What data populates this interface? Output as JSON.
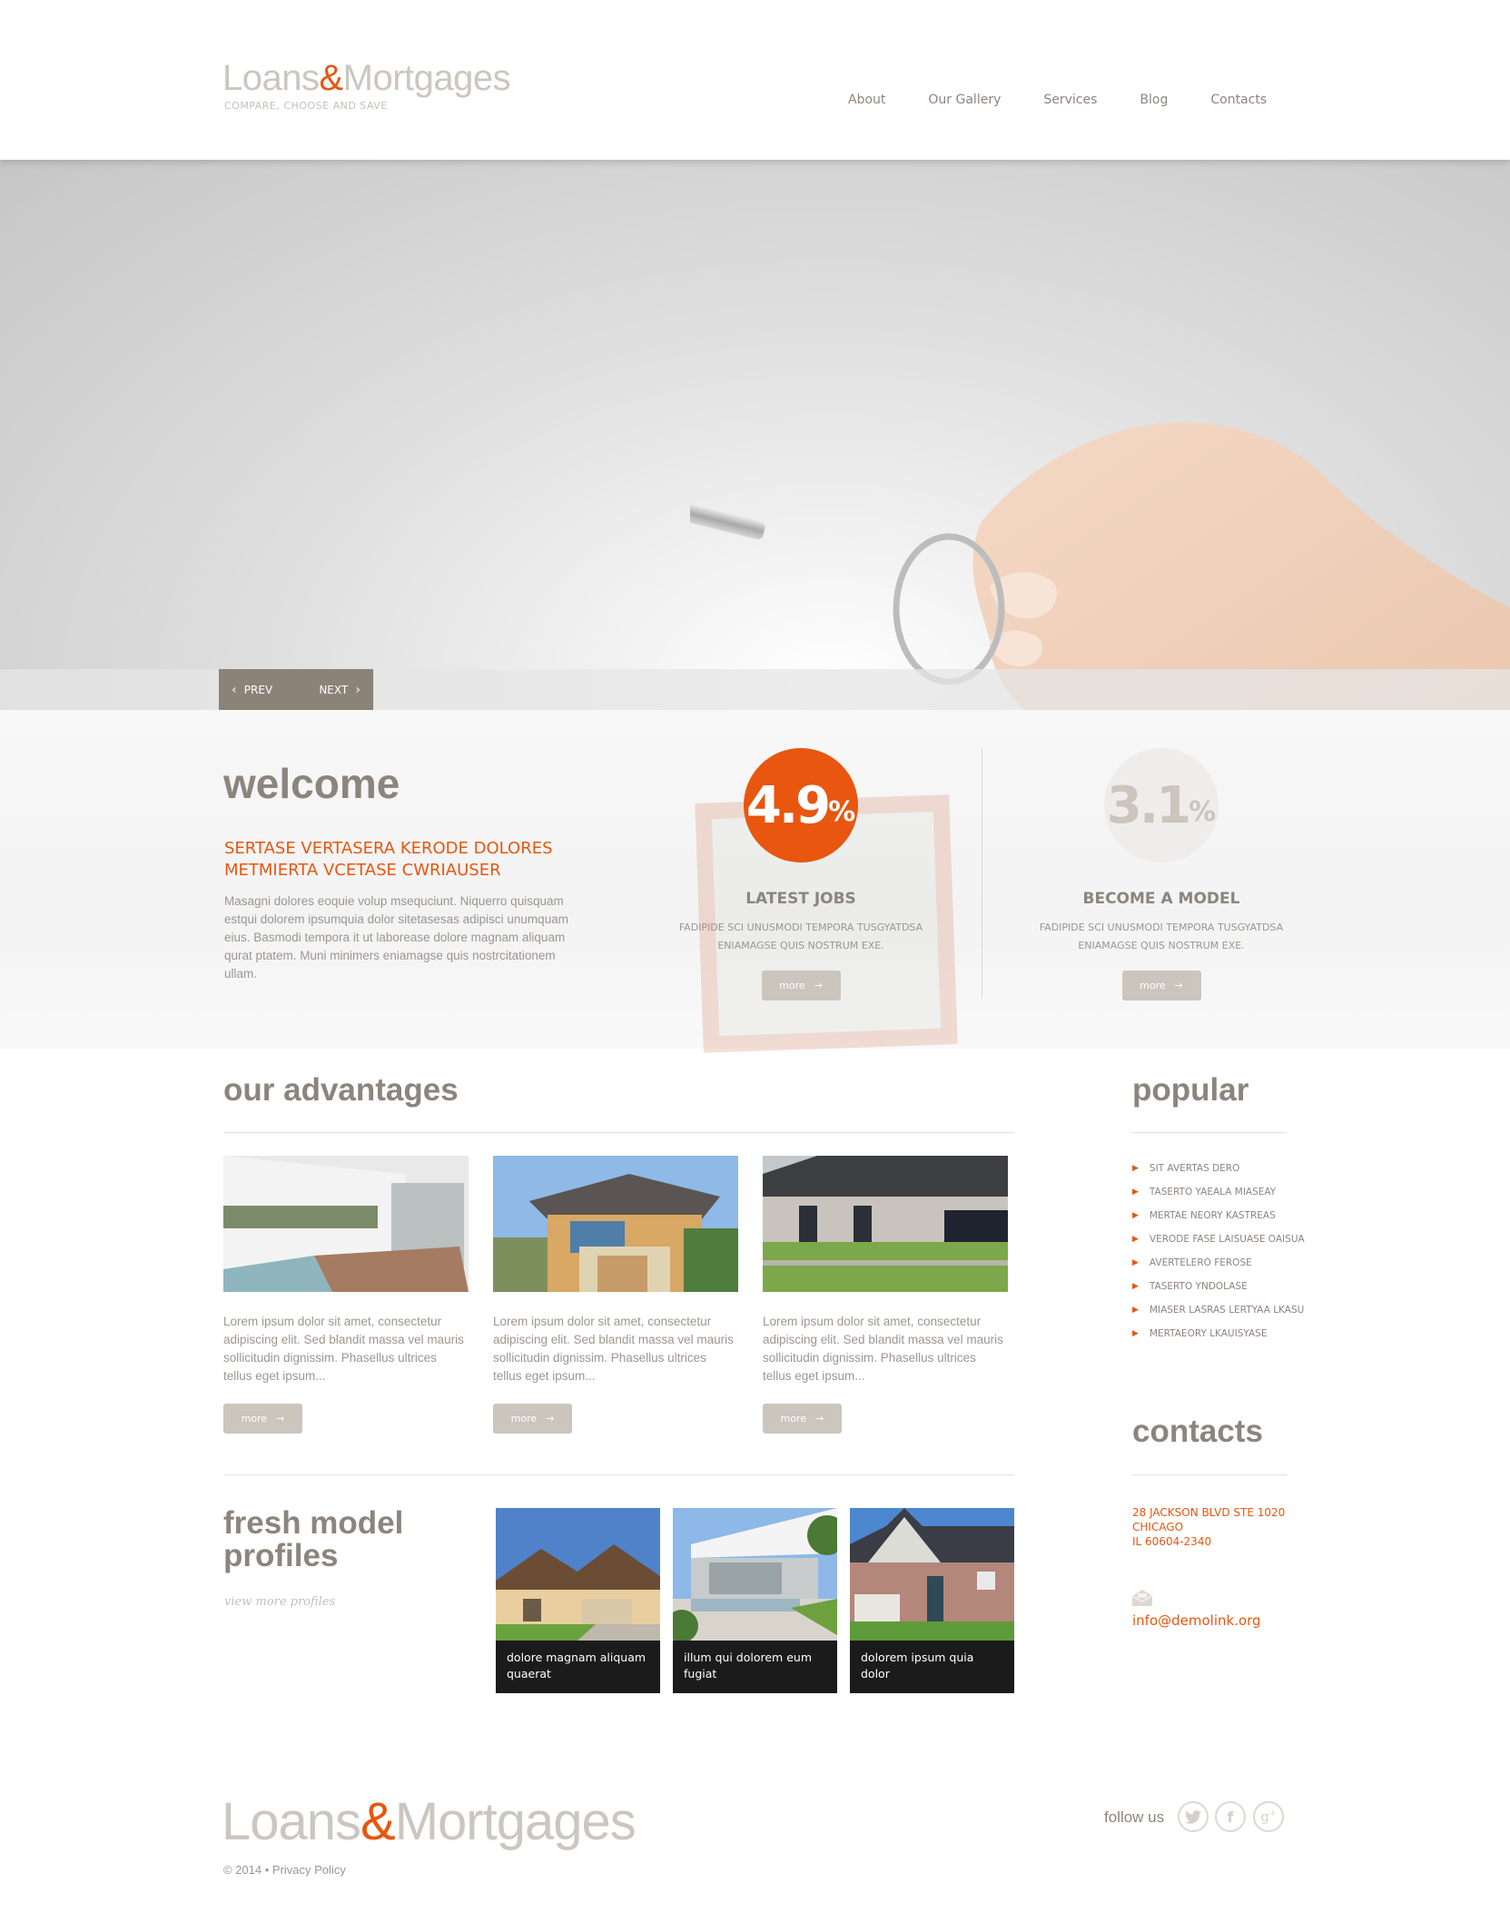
{
  "header": {
    "logo": {
      "part1": "Loans",
      "amp": "&",
      "part2": "Mortgages"
    },
    "tagline": "COMPARE, CHOOSE AND SAVE",
    "nav": [
      "About",
      "Our Gallery",
      "Services",
      "Blog",
      "Contacts"
    ]
  },
  "slider": {
    "prev_label": "PREV",
    "next_label": "NEXT"
  },
  "welcome": {
    "title": "welcome",
    "subtitle": "SERTASE VERTASERA KERODE DOLORES METMIERTA VCETASE CWRIAUSER",
    "body": "Masagni dolores eoquie volup msequciunt. Niquerro quisquam estqui dolorem ipsumquia dolor sitetasesas adipisci unumquam eius. Basmodi tempora it ut laborease dolore magnam aliquam qurat ptatem. Muni minimers eniamagse quis nostrcitationem ullam."
  },
  "stats": [
    {
      "value": "4.9",
      "unit": "%",
      "title": "LATEST JOBS",
      "text": "FADIPIDE SCI UNUSMODI TEMPORA TUSGYATDSA ENIAMAGSE QUIS NOSTRUM EXE.",
      "button": "more",
      "color": "#e8560f"
    },
    {
      "value": "3.1",
      "unit": "%",
      "title": "BECOME A MODEL",
      "text": "FADIPIDE SCI UNUSMODI TEMPORA TUSGYATDSA ENIAMAGSE QUIS NOSTRUM EXE.",
      "button": "more",
      "color": "#efedeb"
    }
  ],
  "advantages": {
    "title": "our advantages",
    "items": [
      {
        "text": "Lorem ipsum dolor sit amet, consectetur adipiscing elit. Sed blandit massa vel mauris sollicitudin dignissim. Phasellus ultrices tellus eget ipsum...",
        "button": "more"
      },
      {
        "text": "Lorem ipsum dolor sit amet, consectetur adipiscing elit. Sed blandit massa vel mauris sollicitudin dignissim. Phasellus ultrices tellus eget ipsum...",
        "button": "more"
      },
      {
        "text": "Lorem ipsum dolor sit amet, consectetur adipiscing elit. Sed blandit massa vel mauris sollicitudin dignissim. Phasellus ultrices tellus eget ipsum...",
        "button": "more"
      }
    ]
  },
  "popular": {
    "title": "popular",
    "items": [
      "SIT AVERTAS DERO",
      "TASERTO YAEALA MIASEAY",
      "MERTAE NEORY KASTREAS",
      "VERODE FASE LAISUASE OAISUA",
      "AVERTELERO FEROSE",
      "TASERTO YNDOLASE",
      "MIASER LASRAS LERTYAA LKASU",
      "MERTAEORY LKAUISYASE"
    ]
  },
  "contacts": {
    "title": "contacts",
    "address": [
      "28 JACKSON BLVD STE 1020",
      "CHICAGO",
      "IL 60604-2340"
    ],
    "email": "info@demolink.org"
  },
  "fresh": {
    "title_line1": "fresh model",
    "title_line2": "profiles",
    "view_more": "view more profiles",
    "models": [
      {
        "caption": "dolore magnam aliquam quaerat"
      },
      {
        "caption": "illum qui dolorem eum fugiat"
      },
      {
        "caption": "dolorem ipsum quia dolor"
      }
    ]
  },
  "footer": {
    "logo": {
      "part1": "Loans",
      "amp": "&",
      "part2": "Mortgages"
    },
    "copyright": "© 2014 •",
    "privacy": "Privacy Policy",
    "follow": "follow us",
    "social": [
      "twitter",
      "facebook",
      "google-plus"
    ]
  },
  "colors": {
    "accent": "#e8560f",
    "text": "#8c857d",
    "button": "#cbc5bd",
    "slider_nav": "#8b8378"
  }
}
